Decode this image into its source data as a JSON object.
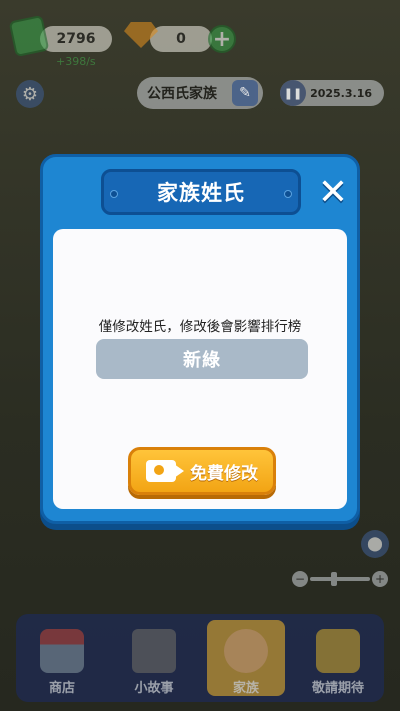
{
  "hud": {
    "money": "2796",
    "money_rate": "+398/s",
    "gems": "0",
    "plus_symbol": "+",
    "family_name_button": "公西氏家族",
    "date": "2025.3.16",
    "icons": [
      "money-icon",
      "gem-icon",
      "plus-icon",
      "gear-icon",
      "edit-icon",
      "pause-icon",
      "map-pin-icon"
    ]
  },
  "zoom": {
    "minus": "−",
    "plus": "+",
    "level": 0.4
  },
  "modal": {
    "title": "家族姓氏",
    "close_symbol": "✕",
    "hint": "僅修改姓氏，修改後會影響排行榜",
    "name_value": "新綠",
    "free_button_label": "免費修改"
  },
  "bottom_nav": {
    "items": [
      {
        "label": "商店",
        "icon": "shop-icon",
        "active": false
      },
      {
        "label": "小故事",
        "icon": "tv-icon",
        "active": false
      },
      {
        "label": "家族",
        "icon": "family-icon",
        "active": true
      },
      {
        "label": "敬請期待",
        "icon": "lock-icon",
        "active": false
      }
    ]
  },
  "colors": {
    "modal_blue": "#1e86d2",
    "button_orange": "#f2a414",
    "field_gray": "#a9b9c8"
  }
}
